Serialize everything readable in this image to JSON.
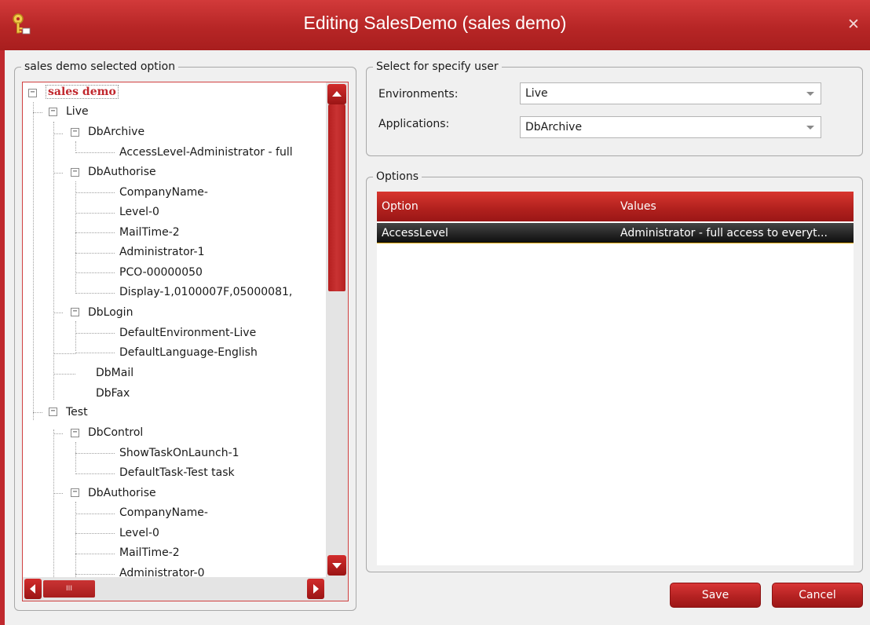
{
  "window": {
    "title": "Editing SalesDemo (sales demo)",
    "close_glyph": "✕",
    "app_icon": "key-icon"
  },
  "left_group": {
    "legend": "sales demo selected option"
  },
  "tree": {
    "root": "sales demo",
    "live": {
      "label": "Live",
      "dbarchive": {
        "label": "DbArchive",
        "items": [
          "AccessLevel-Administrator - full"
        ]
      },
      "dbauthorise": {
        "label": "DbAuthorise",
        "items": [
          "CompanyName-",
          "Level-0",
          "MailTime-2",
          "Administrator-1",
          "PCO-00000050",
          "Display-1,0100007F,05000081,"
        ]
      },
      "dblogin": {
        "label": "DbLogin",
        "items": [
          "DefaultEnvironment-Live",
          "DefaultLanguage-English"
        ]
      },
      "dbmail": "DbMail",
      "dbfax": "DbFax"
    },
    "test": {
      "label": "Test",
      "dbcontrol": {
        "label": "DbControl",
        "items": [
          "ShowTaskOnLaunch-1",
          "DefaultTask-Test task"
        ]
      },
      "dbauthorise": {
        "label": "DbAuthorise",
        "items": [
          "CompanyName-",
          "Level-0",
          "MailTime-2",
          "Administrator-0"
        ]
      }
    },
    "expander_glyph": "−",
    "hscroll_grip": "III"
  },
  "user_group": {
    "legend": "Select for specify user",
    "environments_label": "Environments:",
    "environments_value": "Live",
    "applications_label": "Applications:",
    "applications_value": "DbArchive"
  },
  "options_group": {
    "legend": "Options",
    "columns": [
      "Option",
      "Values"
    ],
    "rows": [
      {
        "option": "AccessLevel",
        "value": "Administrator - full access to everyt..."
      }
    ]
  },
  "buttons": {
    "save": "Save",
    "cancel": "Cancel"
  },
  "colors": {
    "accent": "#b72626",
    "root_text": "#c1272d"
  }
}
